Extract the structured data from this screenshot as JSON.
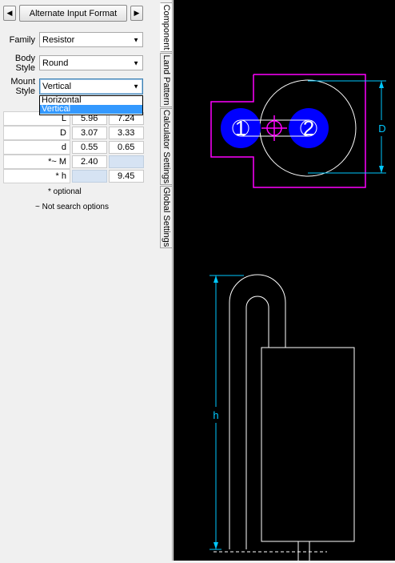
{
  "toolbar": {
    "prev_arrow": "◀",
    "format_button": "Alternate Input Format",
    "next_arrow": "▶"
  },
  "form": {
    "family_label": "Family",
    "family_value": "Resistor",
    "body_style_label": "Body Style",
    "body_style_value": "Round",
    "mount_style_label": "Mount Style",
    "mount_style_value": "Vertical",
    "mount_options": [
      "Horizontal",
      "Vertical"
    ],
    "mount_selected": "Vertical"
  },
  "dimensions": [
    {
      "label": "L",
      "min": "5.96",
      "max": "7.24"
    },
    {
      "label": "D",
      "min": "3.07",
      "max": "3.33"
    },
    {
      "label": "d",
      "min": "0.55",
      "max": "0.65"
    },
    {
      "label": "*~ M",
      "min": "2.40",
      "max": ""
    },
    {
      "label": "* h",
      "min": "",
      "max": "9.45"
    }
  ],
  "notes": {
    "optional": "* optional",
    "not_search": "~ Not search options"
  },
  "tabs": [
    "Component",
    "Land Pattern",
    "Calculator Settings",
    "Global Settings"
  ],
  "drawing": {
    "pad1_label": "1",
    "pad2_label": "2",
    "dim_D_label": "D",
    "dim_h_label": "h",
    "colors": {
      "background": "#000000",
      "pad": "#0000ff",
      "silk": "#ff00ff",
      "outline": "#ffffff",
      "dimension": "#00c8ff"
    }
  }
}
